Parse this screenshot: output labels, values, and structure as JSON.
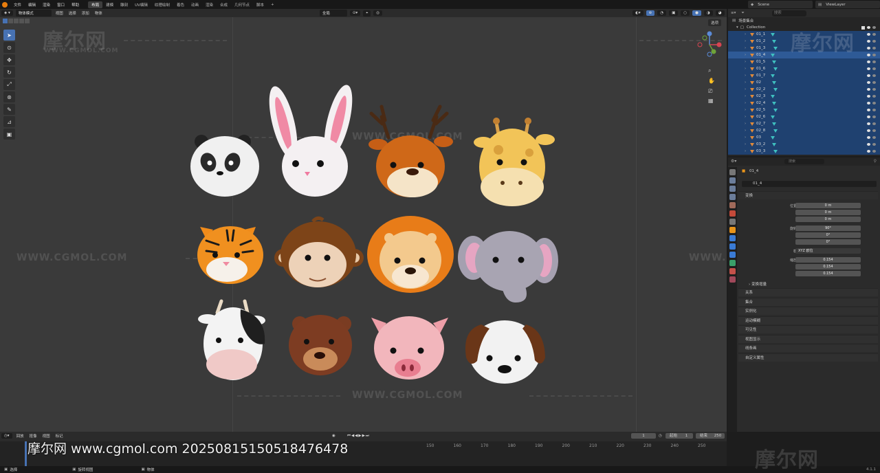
{
  "topbar": {
    "menus": [
      "文件",
      "编辑",
      "渲染",
      "窗口",
      "帮助"
    ],
    "workspaces": [
      "布局",
      "建模",
      "雕刻",
      "UV编辑",
      "纹理绘制",
      "着色",
      "动画",
      "渲染",
      "合成",
      "几何节点",
      "脚本"
    ],
    "active_workspace": "布局",
    "add_tab": "+",
    "scene": "Scene",
    "view_layer": "ViewLayer"
  },
  "viewport": {
    "mode": "物体模式",
    "menus": [
      "视图",
      "选择",
      "添加",
      "物体"
    ],
    "transform_orientation": "全局",
    "options_label": "选项"
  },
  "outliner": {
    "search_placeholder": "搜索",
    "scene_collection": "场景集合",
    "collection": "Collection",
    "objects": [
      "01_1",
      "01_2",
      "01_3",
      "01_4",
      "01_5",
      "01_6",
      "01_7",
      "02",
      "02_2",
      "02_3",
      "02_4",
      "02_5",
      "02_6",
      "02_7",
      "02_8",
      "03",
      "03_2",
      "03_3"
    ],
    "selected_index": 3
  },
  "properties": {
    "search_placeholder": "搜索",
    "object_name": "01_4",
    "object_datablock": "01_4",
    "transform_title": "变换",
    "location": {
      "label": "位置 X",
      "x": "0 m",
      "y": "0 m",
      "z": "0 m"
    },
    "rotation": {
      "label": "旋转 X",
      "x": "90°",
      "y": "0°",
      "z": "0°"
    },
    "mode": {
      "label": "模式",
      "value": "XYZ 欧拉"
    },
    "scale": {
      "label": "缩放 X",
      "x": "0.154",
      "y": "0.154",
      "z": "0.154"
    },
    "axis_y": "Y",
    "axis_z": "Z",
    "delta_transform": "变换增量",
    "panels": [
      "关系",
      "集合",
      "实例化",
      "运动模糊",
      "可见性",
      "视图显示",
      "线条画",
      "自定义属性"
    ]
  },
  "timeline": {
    "menus": [
      "回放",
      "抠像",
      "视图",
      "标记"
    ],
    "current_frame": "1",
    "start_label": "起始",
    "start_value": "1",
    "end_label": "结束",
    "end_value": "250",
    "ticks": [
      "150",
      "160",
      "170",
      "180",
      "190",
      "200",
      "210",
      "220",
      "230",
      "240",
      "250"
    ]
  },
  "status": {
    "select": "选择",
    "rotate": "旋转视图",
    "object": "物体",
    "version": "4.1.1"
  },
  "watermark": {
    "logo": "摩尔网",
    "domain": "WWW.CGMOL.COM",
    "footer": "摩尔网 www.cgmol.com 20250815150518476478"
  },
  "colors": {
    "accent": "#4772b3",
    "viewport_bg": "#3a3a3a",
    "selection_bg": "#1f4170",
    "blender_orange": "#e87d0d"
  }
}
